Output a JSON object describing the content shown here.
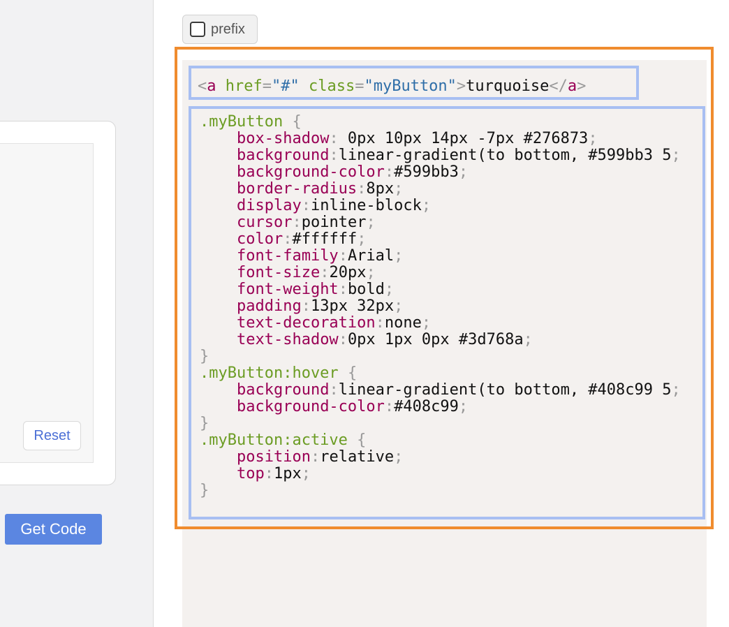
{
  "left": {
    "reset_label": "Reset",
    "get_code_label": "Get Code"
  },
  "prefix": {
    "label": "prefix",
    "checked": false
  },
  "html_code": {
    "tag": "a",
    "href_attr": "href",
    "href_value": "\"#\"",
    "class_attr": "class",
    "class_value": "\"myButton\"",
    "text": "turquoise"
  },
  "css_code": {
    "rules": [
      {
        "selector": ".myButton",
        "declarations": [
          {
            "prop": "box-shadow",
            "value": " 0px 10px 14px -7px #276873"
          },
          {
            "prop": "background",
            "value": "linear-gradient(to bottom, #599bb3 5"
          },
          {
            "prop": "background-color",
            "value": "#599bb3"
          },
          {
            "prop": "border-radius",
            "value": "8px"
          },
          {
            "prop": "display",
            "value": "inline-block"
          },
          {
            "prop": "cursor",
            "value": "pointer"
          },
          {
            "prop": "color",
            "value": "#ffffff"
          },
          {
            "prop": "font-family",
            "value": "Arial"
          },
          {
            "prop": "font-size",
            "value": "20px"
          },
          {
            "prop": "font-weight",
            "value": "bold"
          },
          {
            "prop": "padding",
            "value": "13px 32px"
          },
          {
            "prop": "text-decoration",
            "value": "none"
          },
          {
            "prop": "text-shadow",
            "value": "0px 1px 0px #3d768a"
          }
        ]
      },
      {
        "selector": ".myButton:hover",
        "declarations": [
          {
            "prop": "background",
            "value": "linear-gradient(to bottom, #408c99 5"
          },
          {
            "prop": "background-color",
            "value": "#408c99"
          }
        ]
      },
      {
        "selector": ".myButton:active",
        "declarations": [
          {
            "prop": "position",
            "value": "relative"
          },
          {
            "prop": "top",
            "value": "1px"
          }
        ]
      }
    ]
  },
  "colors": {
    "orange_frame": "#f08c2e",
    "blue_frame": "#a8bff2",
    "get_code_bg": "#5b86e1",
    "code_bg": "#f4f1ef"
  }
}
